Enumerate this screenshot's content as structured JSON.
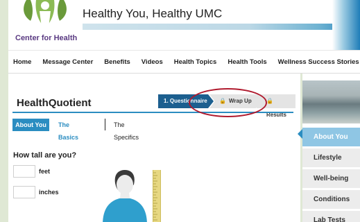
{
  "header": {
    "org_name": "Center for Health",
    "site_title": "Healthy You, Healthy UMC"
  },
  "nav": {
    "items": [
      "Home",
      "Message Center",
      "Benefits",
      "Videos",
      "Health Topics",
      "Health Tools",
      "Wellness Success Stories"
    ]
  },
  "main": {
    "title": "HealthQuotient",
    "steps": [
      {
        "label": "1. Questionnaire",
        "locked": false,
        "active": true
      },
      {
        "label": "Wrap Up",
        "locked": true,
        "active": false
      },
      {
        "label": "Results",
        "locked": true,
        "active": false
      }
    ],
    "subtabs": [
      {
        "label": "About You",
        "active": true
      },
      {
        "label": "The Basics",
        "active": false
      },
      {
        "label": "The Specifics",
        "active": false
      }
    ],
    "question": "How tall are you?",
    "feet_label": "feet",
    "inches_label": "inches",
    "feet_value": "",
    "inches_value": ""
  },
  "sidebar": {
    "items": [
      {
        "label": "About You",
        "active": true
      },
      {
        "label": "Lifestyle",
        "active": false
      },
      {
        "label": "Well-being",
        "active": false
      },
      {
        "label": "Conditions",
        "active": false
      },
      {
        "label": "Lab Tests",
        "active": false
      }
    ]
  },
  "colors": {
    "accent": "#2b8dc1",
    "step_active": "#1c5f8f",
    "highlight_ring": "#b01a2e",
    "org_purple": "#5a3a82",
    "logo_green": "#6a9a3a"
  },
  "icons": [
    "logo-figure-icon",
    "lock-icon",
    "person-silhouette-icon",
    "height-ruler-icon"
  ]
}
